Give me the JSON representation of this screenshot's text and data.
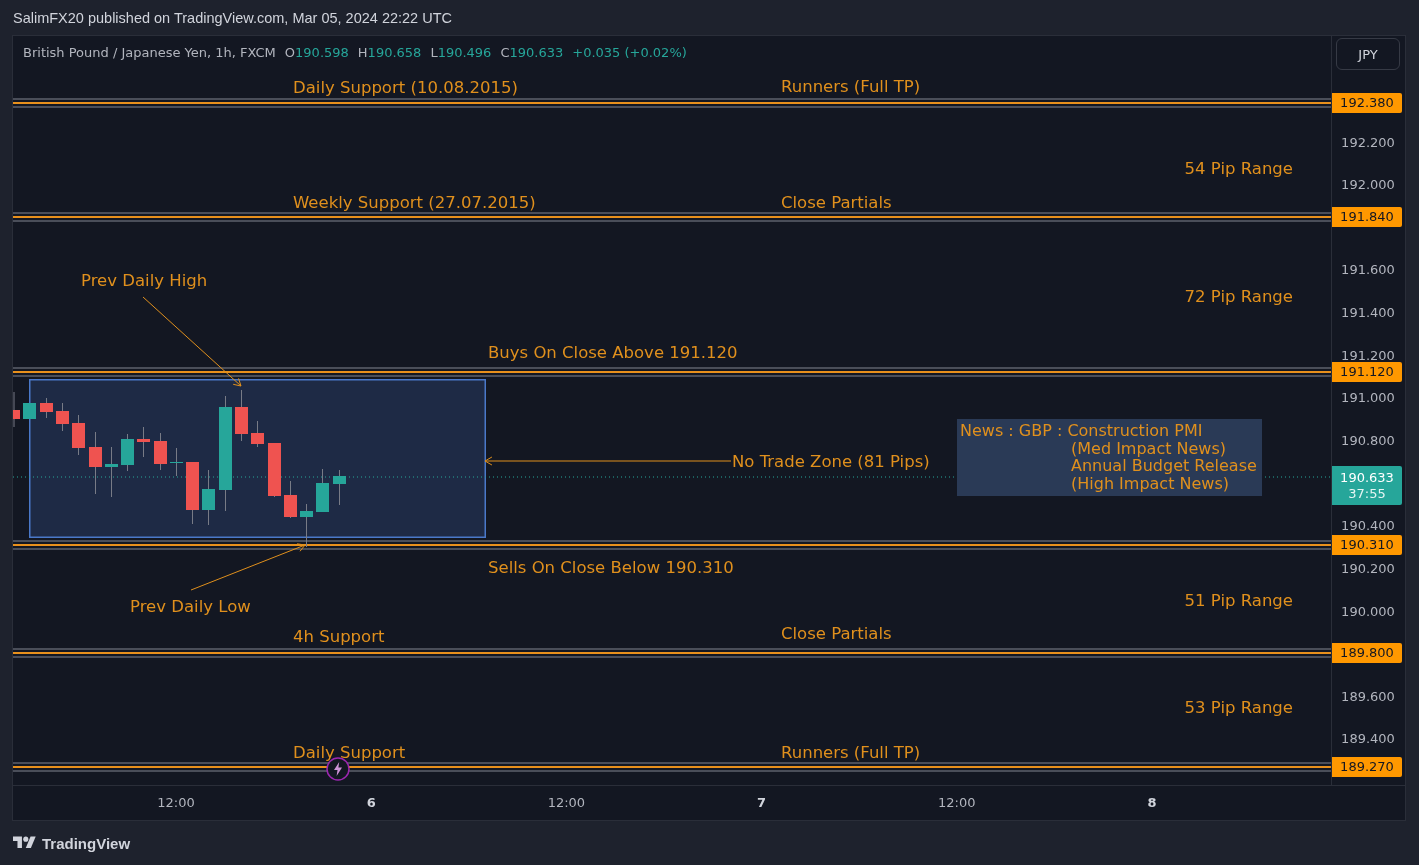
{
  "header": {
    "title": "SalimFX20 published on TradingView.com, Mar 05, 2024 22:22 UTC"
  },
  "legend": {
    "symbol": "British Pound / Japanese Yen, 1h, FXCM",
    "ohlc": [
      {
        "label": "O",
        "value": "190.598"
      },
      {
        "label": "H",
        "value": "190.658"
      },
      {
        "label": "L",
        "value": "190.496"
      },
      {
        "label": "C",
        "value": "190.633"
      }
    ],
    "change": "+0.035 (+0.02%)"
  },
  "currency_button": {
    "label": "JPY"
  },
  "levels": [
    {
      "price": "192.380",
      "labels": [
        "Daily Support (10.08.2015)",
        "Runners (Full TP)"
      ]
    },
    {
      "price": "191.840",
      "labels": [
        "Weekly Support (27.07.2015)",
        "Close Partials"
      ]
    },
    {
      "price": "191.120",
      "labels": [
        "Buys On Close Above 191.120"
      ]
    },
    {
      "price": "190.310",
      "labels": [
        "Sells On Close Below 190.310"
      ]
    },
    {
      "price": "189.800",
      "labels": [
        "4h Support",
        "Close Partials"
      ]
    },
    {
      "price": "189.270",
      "labels": [
        "Daily Support",
        "Runners (Full TP)"
      ]
    }
  ],
  "range_labels": [
    "54 Pip Range",
    "72 Pip Range",
    "51 Pip Range",
    "53 Pip Range"
  ],
  "arrow_notes": [
    "Prev Daily High",
    "No Trade Zone (81 Pips)",
    "Prev Daily Low"
  ],
  "news_note": {
    "lines": [
      "News : GBP : Construction PMI",
      "(Med Impact News)",
      "Annual Budget Release",
      "(High Impact News)"
    ]
  },
  "current_price": {
    "price": "190.633",
    "countdown": "37:55"
  },
  "price_axis": {
    "ticks": [
      "192.200",
      "192.000",
      "191.600",
      "191.400",
      "191.200",
      "191.000",
      "190.800",
      "190.400",
      "190.200",
      "190.000",
      "189.600",
      "189.400"
    ]
  },
  "time_axis": {
    "ticks": [
      {
        "label": "12:00",
        "kind": "time"
      },
      {
        "label": "6",
        "kind": "day"
      },
      {
        "label": "12:00",
        "kind": "time"
      },
      {
        "label": "7",
        "kind": "day"
      },
      {
        "label": "12:00",
        "kind": "time"
      },
      {
        "label": "8",
        "kind": "day"
      }
    ]
  },
  "footer": {
    "brand": "TradingView"
  }
}
